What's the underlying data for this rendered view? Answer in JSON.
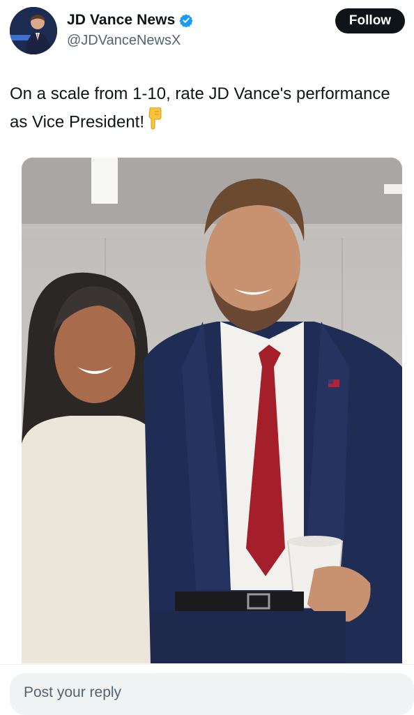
{
  "account": {
    "display_name": "JD Vance News",
    "handle": "@JDVanceNewsX",
    "verified": true,
    "verified_icon": "verified-badge-icon",
    "avatar": "profile-avatar"
  },
  "follow_button": {
    "label": "Follow"
  },
  "tweet": {
    "text": "On a scale from 1-10, rate JD Vance's performance as Vice President!",
    "emoji": "backhand-index-pointing-down-icon"
  },
  "media": {
    "kind": "photo",
    "subject": "two people posing in a hallway"
  },
  "reply": {
    "placeholder": "Post your reply"
  },
  "colors": {
    "text_primary": "#0f1419",
    "text_secondary": "#536471",
    "verified_blue": "#1d9bf0",
    "button_bg": "#0f1419",
    "reply_bg": "#eff3f4"
  }
}
